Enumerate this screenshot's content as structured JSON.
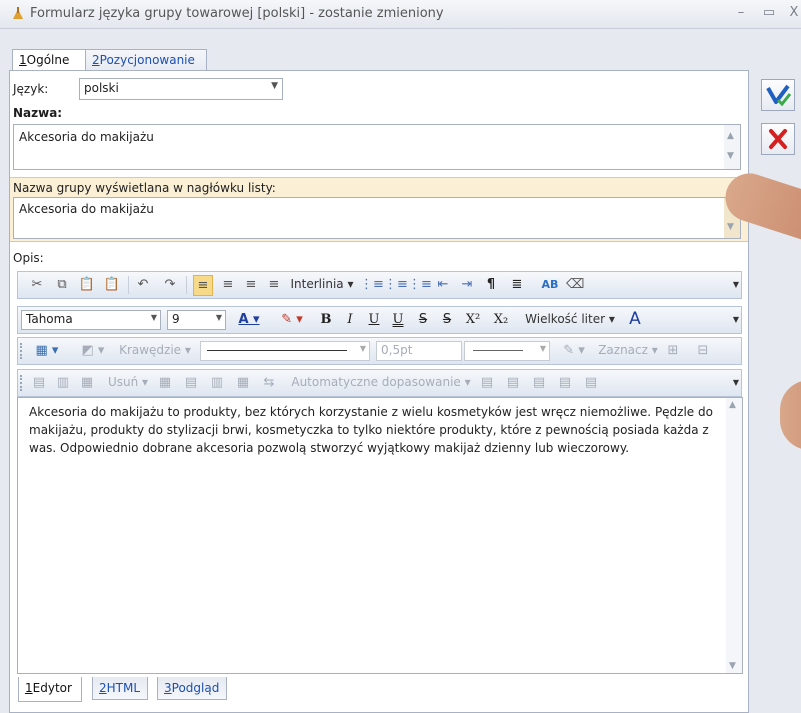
{
  "window": {
    "title": "Formularz języka grupy towarowej [polski] - zostanie zmieniony",
    "controls": [
      "–",
      "▭",
      "X"
    ]
  },
  "tabs": [
    {
      "key": "1",
      "label": "Ogólne"
    },
    {
      "key": "2",
      "label": "Pozycjonowanie"
    }
  ],
  "form": {
    "language_label": "Język:",
    "language_value": "polski",
    "name_label": "Nazwa:",
    "name_value": "Akcesoria do makijażu",
    "header_name_label": "Nazwa grupy wyświetlana w nagłówku listy:",
    "header_name_value": "Akcesoria do makijażu",
    "description_label": "Opis:"
  },
  "toolbar1": {
    "interlinia": "Interlinia",
    "icons": [
      "cut-icon",
      "copy-icon",
      "paste-icon",
      "paste-special-icon",
      "undo-icon",
      "redo-icon",
      "align-left-icon",
      "align-center-icon",
      "align-right-icon",
      "justify-icon",
      "numbered-list-icon",
      "bullet-list-icon",
      "multilevel-list-icon",
      "decrease-indent-icon",
      "increase-indent-icon",
      "pilcrow-icon",
      "rtl-icon",
      "spellcheck-icon",
      "eraser-icon"
    ]
  },
  "toolbar2": {
    "font": "Tahoma",
    "size": "9",
    "bold": "B",
    "italic": "I",
    "underline": "U",
    "double_underline": "U",
    "superscript": "X²",
    "subscript": "X₂",
    "font_size_label": "Wielkość liter"
  },
  "toolbar3": {
    "borders_label": "Krawędzie",
    "border_width": "0,5pt",
    "select_label": "Zaznacz"
  },
  "toolbar4": {
    "delete_label": "Usuń",
    "autofit_label": "Automatyczne dopasowanie"
  },
  "editor": {
    "text": "Akcesoria do makijażu to produkty, bez których korzystanie z wielu kosmetyków jest wręcz niemożliwe. Pędzle do makijażu, produkty do stylizacji brwi, kosmetyczka to tylko niektóre produkty, które z pewnością posiada każda z was. Odpowiednio dobrane akcesoria pozwolą stworzyć wyjątkowy makijaż dzienny lub wieczorowy."
  },
  "bottom_tabs": [
    {
      "key": "1",
      "label": "Edytor"
    },
    {
      "key": "2",
      "label": "HTML"
    },
    {
      "key": "3",
      "label": "Podgląd"
    }
  ],
  "side_buttons": {
    "save": "save-icon",
    "cancel": "cancel-icon"
  },
  "colors": {
    "accent_highlight": "#fbf0d6",
    "cancel_red": "#d42020",
    "save_blue": "#1f5fbf",
    "link_blue": "#1c4fb3"
  }
}
